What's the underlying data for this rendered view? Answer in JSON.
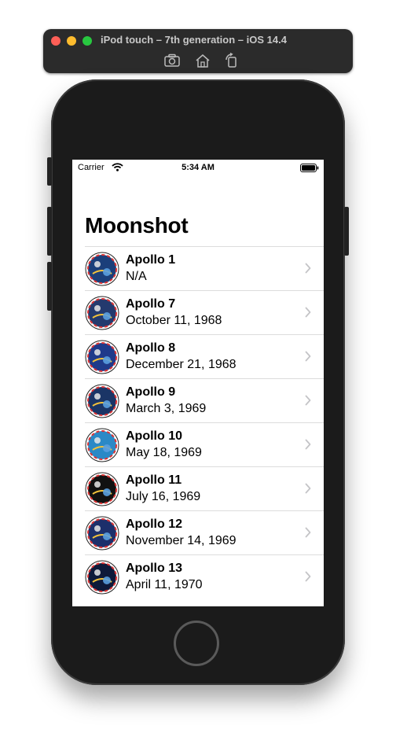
{
  "simulator": {
    "title": "iPod touch – 7th generation – iOS 14.4",
    "tools": [
      {
        "icon": "screenshot-icon"
      },
      {
        "icon": "home-icon"
      },
      {
        "icon": "rotate-icon"
      }
    ]
  },
  "status_bar": {
    "carrier": "Carrier",
    "time": "5:34 AM",
    "wifi_icon": "wifi-icon",
    "battery_icon": "battery-icon"
  },
  "app": {
    "title": "Moonshot",
    "missions": [
      {
        "name": "Apollo 1",
        "date": "N/A",
        "badge_color": "#1b3f7a"
      },
      {
        "name": "Apollo 7",
        "date": "October 11, 1968",
        "badge_color": "#243a6e"
      },
      {
        "name": "Apollo 8",
        "date": "December 21, 1968",
        "badge_color": "#1f3a8a"
      },
      {
        "name": "Apollo 9",
        "date": "March 3, 1969",
        "badge_color": "#1a3566"
      },
      {
        "name": "Apollo 10",
        "date": "May 18, 1969",
        "badge_color": "#2b89c6"
      },
      {
        "name": "Apollo 11",
        "date": "July 16, 1969",
        "badge_color": "#111111"
      },
      {
        "name": "Apollo 12",
        "date": "November 14, 1969",
        "badge_color": "#1c2f6b"
      },
      {
        "name": "Apollo 13",
        "date": "April 11, 1970",
        "badge_color": "#0e1a3a"
      }
    ]
  },
  "colors": {
    "accent_red": "#fe5f57",
    "accent_yellow": "#febc2e",
    "accent_green": "#28c840",
    "chevron": "#c4c4c7",
    "separator": "#dcdcdc"
  }
}
